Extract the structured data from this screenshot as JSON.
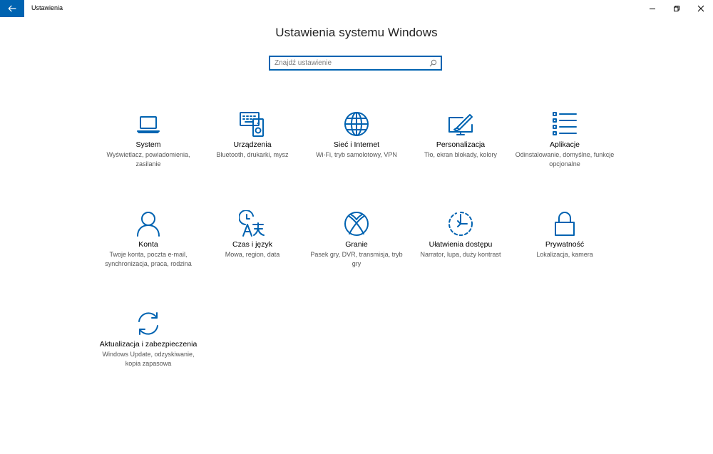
{
  "window": {
    "app_title": "Ustawienia"
  },
  "page": {
    "title": "Ustawienia systemu Windows"
  },
  "search": {
    "placeholder": "Znajdź ustawienie"
  },
  "tiles": [
    {
      "name": "System",
      "desc": "Wyświetlacz, powiadomienia, zasilanie",
      "icon": "laptop-icon"
    },
    {
      "name": "Urządzenia",
      "desc": "Bluetooth, drukarki, mysz",
      "icon": "devices-icon"
    },
    {
      "name": "Sieć i Internet",
      "desc": "Wi-Fi, tryb samolotowy, VPN",
      "icon": "globe-icon"
    },
    {
      "name": "Personalizacja",
      "desc": "Tło, ekran blokady, kolory",
      "icon": "paint-icon"
    },
    {
      "name": "Aplikacje",
      "desc": "Odinstalowanie, domyślne, funkcje opcjonalne",
      "icon": "apps-list-icon"
    },
    {
      "name": "Konta",
      "desc": "Twoje konta, poczta e-mail, synchronizacja, praca, rodzina",
      "icon": "person-icon"
    },
    {
      "name": "Czas i język",
      "desc": "Mowa, region, data",
      "icon": "time-language-icon"
    },
    {
      "name": "Granie",
      "desc": "Pasek gry, DVR, transmisja, tryb gry",
      "icon": "xbox-icon"
    },
    {
      "name": "Ułatwienia dostępu",
      "desc": "Narrator, lupa, duży kontrast",
      "icon": "accessibility-icon"
    },
    {
      "name": "Prywatność",
      "desc": "Lokalizacja, kamera",
      "icon": "lock-icon"
    },
    {
      "name": "Aktualizacja i zabezpieczenia",
      "desc": "Windows Update, odzyskiwanie, kopia zapasowa",
      "icon": "sync-icon"
    }
  ],
  "colors": {
    "accent": "#0063b1"
  }
}
